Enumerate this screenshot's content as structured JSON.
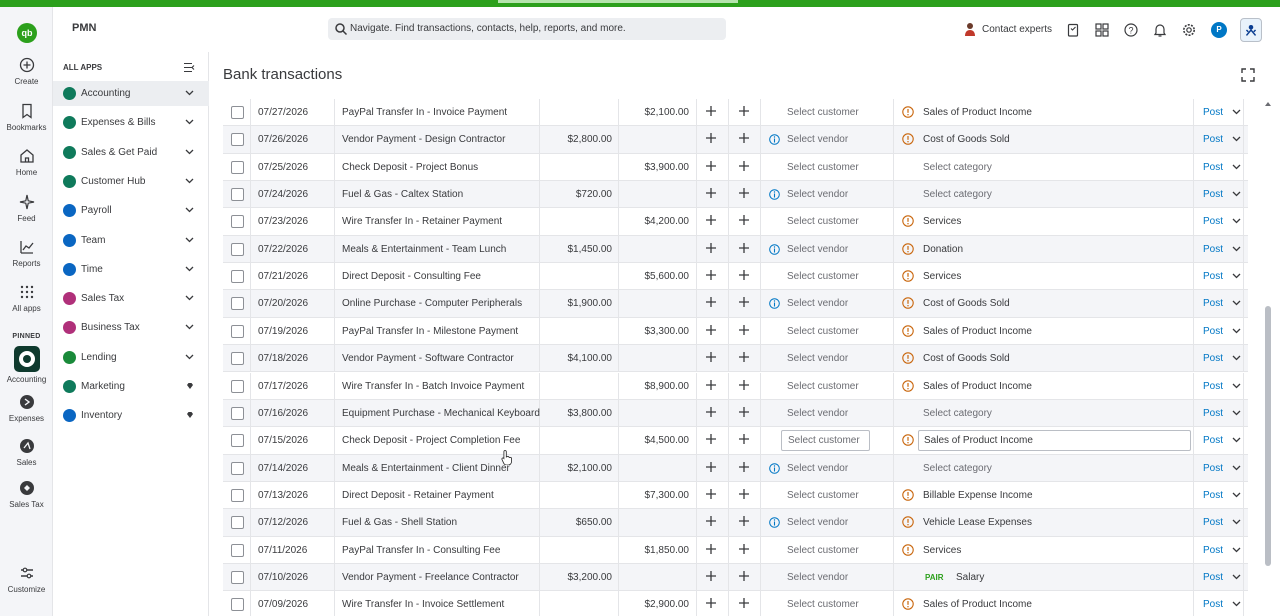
{
  "header": {
    "company": "PMN",
    "search_placeholder": "Navigate. Find transactions, contacts, help, reports, and more.",
    "contact_label": "Contact experts",
    "avatar_letter": "P"
  },
  "rail": {
    "items": [
      {
        "label": "Create",
        "icon": "plus-circle-icon"
      },
      {
        "label": "Bookmarks",
        "icon": "bookmark-icon"
      },
      {
        "label": "Home",
        "icon": "home-icon"
      },
      {
        "label": "Feed",
        "icon": "sparkle-icon"
      },
      {
        "label": "Reports",
        "icon": "chart-icon"
      },
      {
        "label": "All apps",
        "icon": "grid-icon"
      }
    ],
    "pinned_label": "PINNED",
    "pinned": [
      {
        "label": "Accounting",
        "icon": "accounting-icon"
      },
      {
        "label": "Expenses",
        "icon": "expenses-icon"
      },
      {
        "label": "Sales",
        "icon": "sales-icon"
      },
      {
        "label": "Sales Tax",
        "icon": "sales-tax-icon"
      }
    ],
    "customize_label": "Customize",
    "logo_text": "qb"
  },
  "panel": {
    "title": "ALL APPS",
    "items": [
      {
        "label": "Accounting",
        "color": "#0f7a5b",
        "active": true
      },
      {
        "label": "Expenses & Bills",
        "color": "#0f7a5b"
      },
      {
        "label": "Sales & Get Paid",
        "color": "#0f7a5b"
      },
      {
        "label": "Customer Hub",
        "color": "#0f7a5b"
      },
      {
        "label": "Payroll",
        "color": "#0a66c2"
      },
      {
        "label": "Team",
        "color": "#0a66c2"
      },
      {
        "label": "Time",
        "color": "#0a66c2"
      },
      {
        "label": "Sales Tax",
        "color": "#b0307a"
      },
      {
        "label": "Business Tax",
        "color": "#b0307a"
      },
      {
        "label": "Lending",
        "color": "#1a8a3a"
      },
      {
        "label": "Marketing",
        "color": "#0f7a5b",
        "gem": true
      },
      {
        "label": "Inventory",
        "color": "#0a66c2",
        "gem": true
      }
    ]
  },
  "page": {
    "title": "Bank transactions"
  },
  "transactions": [
    {
      "date": "07/27/2026",
      "desc": "PayPal Transfer In - Invoice Payment",
      "spent": "",
      "received": "$2,100.00",
      "payee": "Select customer",
      "info": false,
      "warn": true,
      "category": "Sales of Product Income",
      "cat_placeholder": false
    },
    {
      "date": "07/26/2026",
      "desc": "Vendor Payment - Design Contractor",
      "spent": "$2,800.00",
      "received": "",
      "payee": "Select vendor",
      "info": true,
      "warn": true,
      "category": "Cost of Goods Sold",
      "cat_placeholder": false
    },
    {
      "date": "07/25/2026",
      "desc": "Check Deposit - Project Bonus",
      "spent": "",
      "received": "$3,900.00",
      "payee": "Select customer",
      "info": false,
      "warn": false,
      "category": "Select category",
      "cat_placeholder": true
    },
    {
      "date": "07/24/2026",
      "desc": "Fuel & Gas - Caltex Station",
      "spent": "$720.00",
      "received": "",
      "payee": "Select vendor",
      "info": true,
      "warn": false,
      "category": "Select category",
      "cat_placeholder": true
    },
    {
      "date": "07/23/2026",
      "desc": "Wire Transfer In - Retainer Payment",
      "spent": "",
      "received": "$4,200.00",
      "payee": "Select customer",
      "info": false,
      "warn": true,
      "category": "Services",
      "cat_placeholder": false
    },
    {
      "date": "07/22/2026",
      "desc": "Meals & Entertainment - Team Lunch",
      "spent": "$1,450.00",
      "received": "",
      "payee": "Select vendor",
      "info": true,
      "warn": true,
      "category": "Donation",
      "cat_placeholder": false
    },
    {
      "date": "07/21/2026",
      "desc": "Direct Deposit - Consulting Fee",
      "spent": "",
      "received": "$5,600.00",
      "payee": "Select customer",
      "info": false,
      "warn": true,
      "category": "Services",
      "cat_placeholder": false
    },
    {
      "date": "07/20/2026",
      "desc": "Online Purchase - Computer Peripherals",
      "spent": "$1,900.00",
      "received": "",
      "payee": "Select vendor",
      "info": true,
      "warn": true,
      "category": "Cost of Goods Sold",
      "cat_placeholder": false
    },
    {
      "date": "07/19/2026",
      "desc": "PayPal Transfer In - Milestone Payment",
      "spent": "",
      "received": "$3,300.00",
      "payee": "Select customer",
      "info": false,
      "warn": true,
      "category": "Sales of Product Income",
      "cat_placeholder": false
    },
    {
      "date": "07/18/2026",
      "desc": "Vendor Payment - Software Contractor",
      "spent": "$4,100.00",
      "received": "",
      "payee": "Select vendor",
      "info": false,
      "warn": true,
      "category": "Cost of Goods Sold",
      "cat_placeholder": false
    },
    {
      "date": "07/17/2026",
      "desc": "Wire Transfer In - Batch Invoice Payment",
      "spent": "",
      "received": "$8,900.00",
      "payee": "Select customer",
      "info": false,
      "warn": true,
      "category": "Sales of Product Income",
      "cat_placeholder": false
    },
    {
      "date": "07/16/2026",
      "desc": "Equipment Purchase - Mechanical Keyboard",
      "spent": "$3,800.00",
      "received": "",
      "payee": "Select vendor",
      "info": false,
      "warn": false,
      "category": "Select category",
      "cat_placeholder": true
    },
    {
      "date": "07/15/2026",
      "desc": "Check Deposit - Project Completion Fee",
      "spent": "",
      "received": "$4,500.00",
      "payee": "Select customer",
      "info": false,
      "warn": true,
      "category": "Sales of Product Income",
      "cat_placeholder": false,
      "editing": true
    },
    {
      "date": "07/14/2026",
      "desc": "Meals & Entertainment - Client Dinner",
      "spent": "$2,100.00",
      "received": "",
      "payee": "Select vendor",
      "info": true,
      "warn": false,
      "category": "Select category",
      "cat_placeholder": true
    },
    {
      "date": "07/13/2026",
      "desc": "Direct Deposit - Retainer Payment",
      "spent": "",
      "received": "$7,300.00",
      "payee": "Select customer",
      "info": false,
      "warn": true,
      "category": "Billable Expense Income",
      "cat_placeholder": false
    },
    {
      "date": "07/12/2026",
      "desc": "Fuel & Gas - Shell Station",
      "spent": "$650.00",
      "received": "",
      "payee": "Select vendor",
      "info": true,
      "warn": true,
      "category": "Vehicle Lease Expenses",
      "cat_placeholder": false
    },
    {
      "date": "07/11/2026",
      "desc": "PayPal Transfer In - Consulting Fee",
      "spent": "",
      "received": "$1,850.00",
      "payee": "Select customer",
      "info": false,
      "warn": true,
      "category": "Services",
      "cat_placeholder": false
    },
    {
      "date": "07/10/2026",
      "desc": "Vendor Payment - Freelance Contractor",
      "spent": "$3,200.00",
      "received": "",
      "payee": "Select vendor",
      "info": false,
      "warn": false,
      "category": "Salary",
      "cat_placeholder": false,
      "pair": "PAIR"
    },
    {
      "date": "07/09/2026",
      "desc": "Wire Transfer In - Invoice Settlement",
      "spent": "",
      "received": "$2,900.00",
      "payee": "Select customer",
      "info": false,
      "warn": true,
      "category": "Sales of Product Income",
      "cat_placeholder": false
    }
  ],
  "post_label": "Post",
  "colors": {
    "brand_green": "#2ca01c",
    "link_blue": "#0077c5",
    "warn_orange": "#c9670e",
    "info_blue": "#0077c5"
  }
}
